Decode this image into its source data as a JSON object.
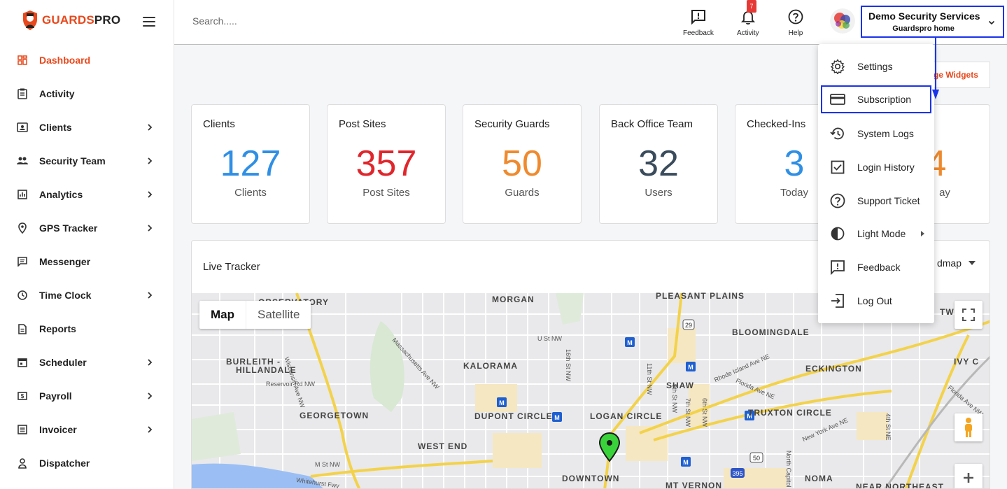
{
  "brand": {
    "name_part1": "GUARDS",
    "name_part2": "PRO",
    "accent_color": "#e8481c"
  },
  "sidebar": {
    "items": [
      {
        "label": "Dashboard",
        "icon": "dashboard-icon",
        "active": true,
        "has_submenu": false
      },
      {
        "label": "Activity",
        "icon": "clipboard-icon",
        "active": false,
        "has_submenu": false
      },
      {
        "label": "Clients",
        "icon": "contact-card-icon",
        "active": false,
        "has_submenu": true
      },
      {
        "label": "Security Team",
        "icon": "people-icon",
        "active": false,
        "has_submenu": true
      },
      {
        "label": "Analytics",
        "icon": "bar-chart-icon",
        "active": false,
        "has_submenu": true
      },
      {
        "label": "GPS Tracker",
        "icon": "location-pin-icon",
        "active": false,
        "has_submenu": true
      },
      {
        "label": "Messenger",
        "icon": "chat-icon",
        "active": false,
        "has_submenu": false
      },
      {
        "label": "Time Clock",
        "icon": "clock-icon",
        "active": false,
        "has_submenu": true
      },
      {
        "label": "Reports",
        "icon": "document-icon",
        "active": false,
        "has_submenu": false
      },
      {
        "label": "Scheduler",
        "icon": "calendar-icon",
        "active": false,
        "has_submenu": true
      },
      {
        "label": "Payroll",
        "icon": "money-icon",
        "active": false,
        "has_submenu": true
      },
      {
        "label": "Invoicer",
        "icon": "list-icon",
        "active": false,
        "has_submenu": true
      },
      {
        "label": "Dispatcher",
        "icon": "person-icon",
        "active": false,
        "has_submenu": false
      }
    ]
  },
  "header": {
    "search_placeholder": "Search.....",
    "feedback_label": "Feedback",
    "activity_label": "Activity",
    "activity_count": "7",
    "help_label": "Help",
    "account_name": "Demo Security Services",
    "account_sub": "Guardspro home"
  },
  "dashboard": {
    "manage_widgets_label": "ge Widgets",
    "cards": [
      {
        "title": "Clients",
        "value": "127",
        "subtitle": "Clients",
        "color": "#2f8fe4"
      },
      {
        "title": "Post Sites",
        "value": "357",
        "subtitle": "Post Sites",
        "color": "#e0262c"
      },
      {
        "title": "Security Guards",
        "value": "50",
        "subtitle": "Guards",
        "color": "#ef8a2e"
      },
      {
        "title": "Back Office Team",
        "value": "32",
        "subtitle": "Users",
        "color": "#3a4b5c"
      },
      {
        "title": "Checked-Ins",
        "value": "3",
        "subtitle": "Today",
        "color": "#2f8fe4"
      },
      {
        "title": "ns",
        "value": "4",
        "subtitle": "ay",
        "color": "#ef8a2e"
      }
    ],
    "tracker": {
      "title": "Live Tracker",
      "map_style_selected": "dmap",
      "map_type_map": "Map",
      "map_type_satellite": "Satellite",
      "map_labels": [
        "PLEASANT PLAINS",
        "MORGAN",
        "BLOOMINGDALE",
        "BURLEITH -",
        "HILLANDALE",
        "KALORAMA",
        "SHAW",
        "ECKINGTON",
        "GEORGETOWN",
        "DUPONT CIRCLE",
        "LOGAN CIRCLE",
        "TRUXTON CIRCLE",
        "WEST END",
        "DOWNTOWN",
        "MT VERNON",
        "NOMA",
        "OBSERVATORY",
        "NEAR NORTHEAST",
        "IVY C",
        "TWO"
      ],
      "street_labels": [
        "Wisconsin Ave NW",
        "Massachusetts Ave NW",
        "Reservoir Rd NW",
        "U St NW",
        "16th St NW",
        "11th St NW",
        "7th St NW",
        "9th St NW",
        "6th St NW",
        "Rhode Island Ave NE",
        "Florida Ave NE",
        "New York Ave NE",
        "M St NW",
        "Whitehurst Fwy",
        "North Capitol",
        "4th St NE",
        "Florida Ave NW"
      ],
      "route_shields": [
        "29",
        "50",
        "395"
      ]
    }
  },
  "account_menu": {
    "items": [
      {
        "label": "Settings",
        "icon": "gear-icon",
        "highlighted": false
      },
      {
        "label": "Subscription",
        "icon": "credit-card-icon",
        "highlighted": true
      },
      {
        "label": "System Logs",
        "icon": "history-icon",
        "highlighted": false
      },
      {
        "label": "Login History",
        "icon": "checkbox-icon",
        "highlighted": false
      },
      {
        "label": "Support Ticket",
        "icon": "help-circle-icon",
        "highlighted": false
      },
      {
        "label": "Light Mode",
        "icon": "contrast-icon",
        "highlighted": false,
        "has_submenu": true
      },
      {
        "label": "Feedback",
        "icon": "feedback-icon",
        "highlighted": false
      },
      {
        "label": "Log Out",
        "icon": "logout-icon",
        "highlighted": false
      }
    ]
  },
  "annotation_color": "#1a33e8"
}
